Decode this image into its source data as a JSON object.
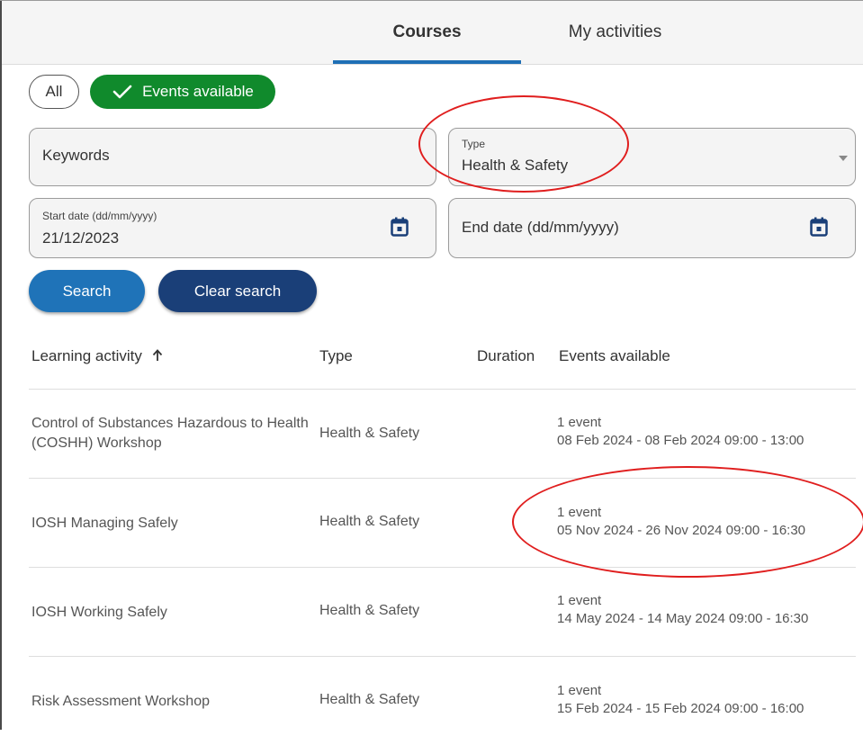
{
  "tabs": [
    {
      "label": "Courses",
      "active": true
    },
    {
      "label": "My activities",
      "active": false
    }
  ],
  "filters": {
    "all_label": "All",
    "events_available_label": "Events available"
  },
  "form": {
    "keywords_placeholder": "Keywords",
    "type_label": "Type",
    "type_value": "Health & Safety",
    "start_date_label": "Start date (dd/mm/yyyy)",
    "start_date_value": "21/12/2023",
    "end_date_placeholder": "End date (dd/mm/yyyy)"
  },
  "buttons": {
    "search": "Search",
    "clear": "Clear search"
  },
  "table": {
    "headers": {
      "activity": "Learning activity",
      "type": "Type",
      "duration": "Duration",
      "events": "Events available"
    },
    "rows": [
      {
        "name": "Control of Substances Hazardous to Health (COSHH) Workshop",
        "type": "Health & Safety",
        "count": "1 event",
        "dates": "08 Feb 2024 - 08 Feb 2024 09:00 - 13:00"
      },
      {
        "name": "IOSH Managing Safely",
        "type": "Health & Safety",
        "count": "1 event",
        "dates": "05 Nov 2024 - 26 Nov 2024 09:00 - 16:30"
      },
      {
        "name": "IOSH Working Safely",
        "type": "Health & Safety",
        "count": "1 event",
        "dates": "14 May 2024 - 14 May 2024 09:00 - 16:30"
      },
      {
        "name": "Risk Assessment Workshop",
        "type": "Health & Safety",
        "count": "1 event",
        "dates": "15 Feb 2024 - 15 Feb 2024 09:00 - 16:00"
      }
    ]
  },
  "colors": {
    "accent_blue": "#1f73b8",
    "dark_blue": "#1a3f78",
    "success_green": "#108a2c",
    "annotation_red": "#e01e1e"
  }
}
